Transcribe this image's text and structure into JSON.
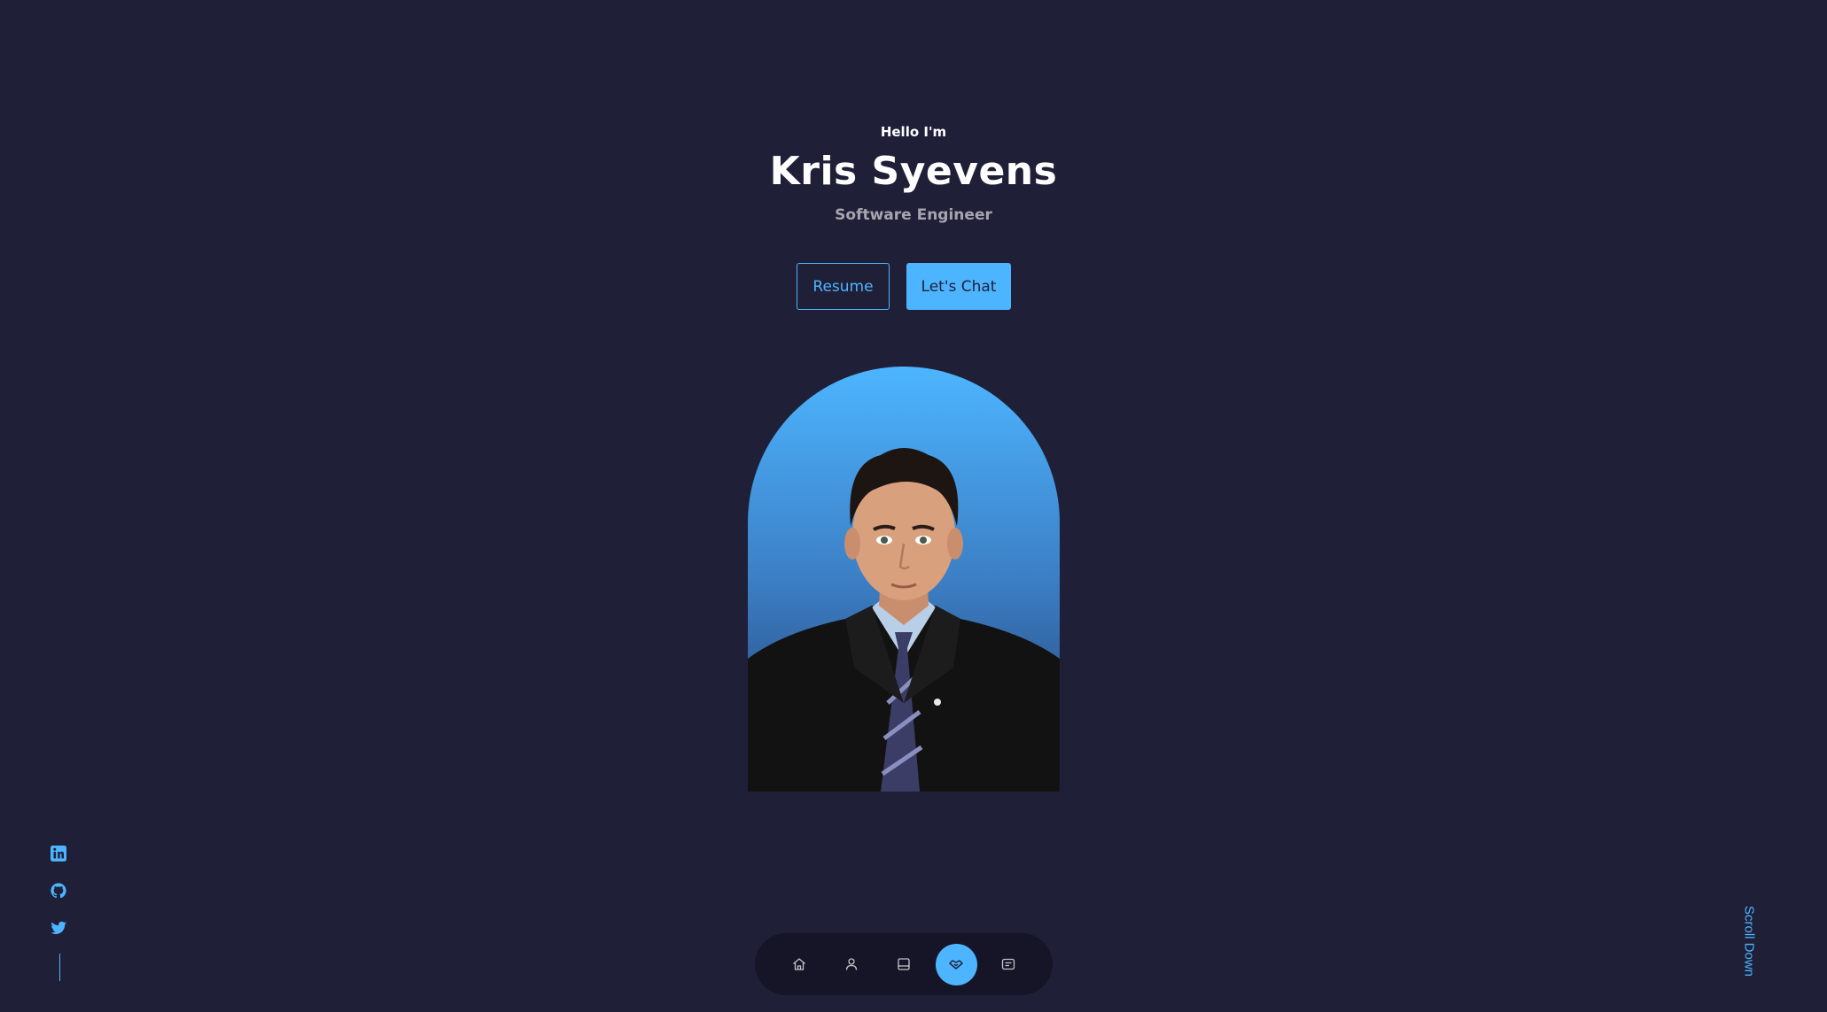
{
  "hero": {
    "greeting": "Hello I'm",
    "name": "Kris Syevens",
    "role": "Software Engineer"
  },
  "cta": {
    "resume_label": "Resume",
    "chat_label": "Let's Chat"
  },
  "social": {
    "icons": [
      "linkedin-icon",
      "github-icon",
      "twitter-icon"
    ]
  },
  "scroll": {
    "label": "Scroll Down"
  },
  "nav": {
    "items": [
      {
        "icon": "home-icon",
        "active": false
      },
      {
        "icon": "user-icon",
        "active": false
      },
      {
        "icon": "book-icon",
        "active": false
      },
      {
        "icon": "handshake-icon",
        "active": true
      },
      {
        "icon": "message-icon",
        "active": false
      }
    ]
  },
  "colors": {
    "background": "#1f1f38",
    "accent": "#4db5ff",
    "text": "#ffffff"
  }
}
